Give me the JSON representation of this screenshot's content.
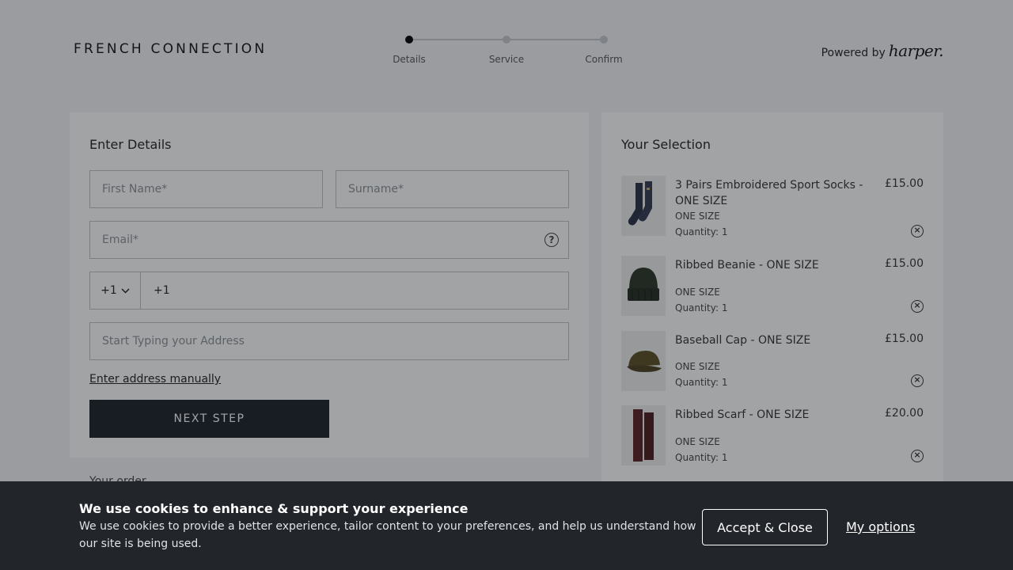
{
  "brand": {
    "logo_text": "FRENCH CONNECTION",
    "powered_by": "Powered by",
    "partner": "harper."
  },
  "steps": [
    {
      "label": "Details",
      "active": true
    },
    {
      "label": "Service",
      "active": false
    },
    {
      "label": "Confirm",
      "active": false
    }
  ],
  "form": {
    "title": "Enter Details",
    "first_name_placeholder": "First Name*",
    "surname_placeholder": "Surname*",
    "email_placeholder": "Email*",
    "phone_code": "+1",
    "phone_value": "+1",
    "address_placeholder": "Start Typing your Address",
    "manual_link": "Enter address manually",
    "next_button": "NEXT STEP",
    "partial_section_text": "Your order"
  },
  "selection": {
    "title": "Your Selection",
    "items": [
      {
        "name": "3 Pairs Embroidered Sport Socks - ONE SIZE",
        "price": "£15.00",
        "size": "ONE SIZE",
        "quantity": "Quantity: 1"
      },
      {
        "name": "Ribbed Beanie - ONE SIZE",
        "price": "£15.00",
        "size": "ONE SIZE",
        "quantity": "Quantity: 1"
      },
      {
        "name": "Baseball Cap - ONE SIZE",
        "price": "£15.00",
        "size": "ONE SIZE",
        "quantity": "Quantity: 1"
      },
      {
        "name": "Ribbed Scarf - ONE SIZE",
        "price": "£20.00",
        "size": "ONE SIZE",
        "quantity": "Quantity: 1"
      }
    ]
  },
  "cookie": {
    "title": "We use cookies to enhance & support your experience",
    "body": "We use cookies to provide a better experience, tailor content to your preferences, and help us understand how our site is being used.",
    "accept": "Accept & Close",
    "options": "My options"
  },
  "colors": {
    "overlay": "#000000",
    "cookie_bg": "#22252a",
    "button_dark": "#1c2028"
  },
  "icons": {
    "help": "help-icon",
    "chevron": "chevron-down-icon",
    "remove": "remove-circle-icon"
  }
}
